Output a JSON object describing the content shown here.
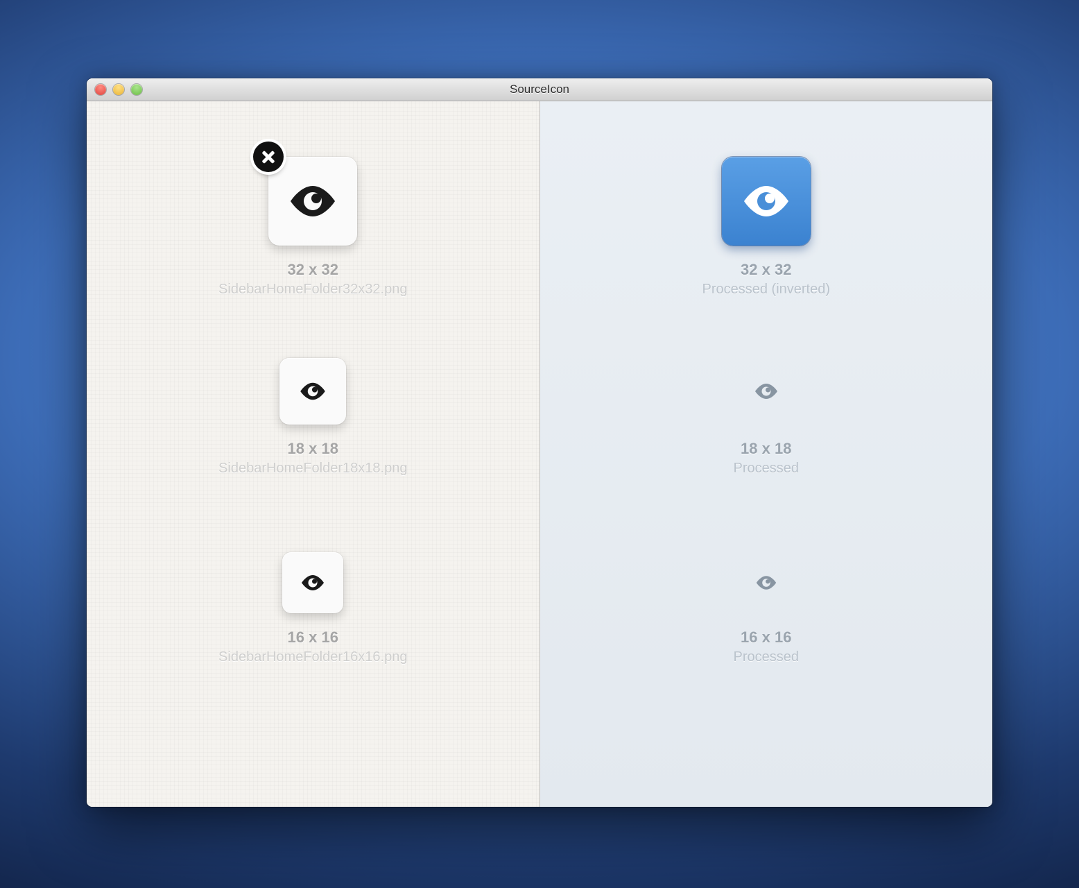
{
  "window": {
    "title": "SourceIcon"
  },
  "left": {
    "items": [
      {
        "size": "32 x 32",
        "filename": "SidebarHomeFolder32x32.png"
      },
      {
        "size": "18 x 18",
        "filename": "SidebarHomeFolder18x18.png"
      },
      {
        "size": "16 x 16",
        "filename": "SidebarHomeFolder16x16.png"
      }
    ]
  },
  "right": {
    "items": [
      {
        "size": "32 x 32",
        "status": "Processed (inverted)"
      },
      {
        "size": "18 x 18",
        "status": "Processed"
      },
      {
        "size": "16 x 16",
        "status": "Processed"
      }
    ]
  }
}
